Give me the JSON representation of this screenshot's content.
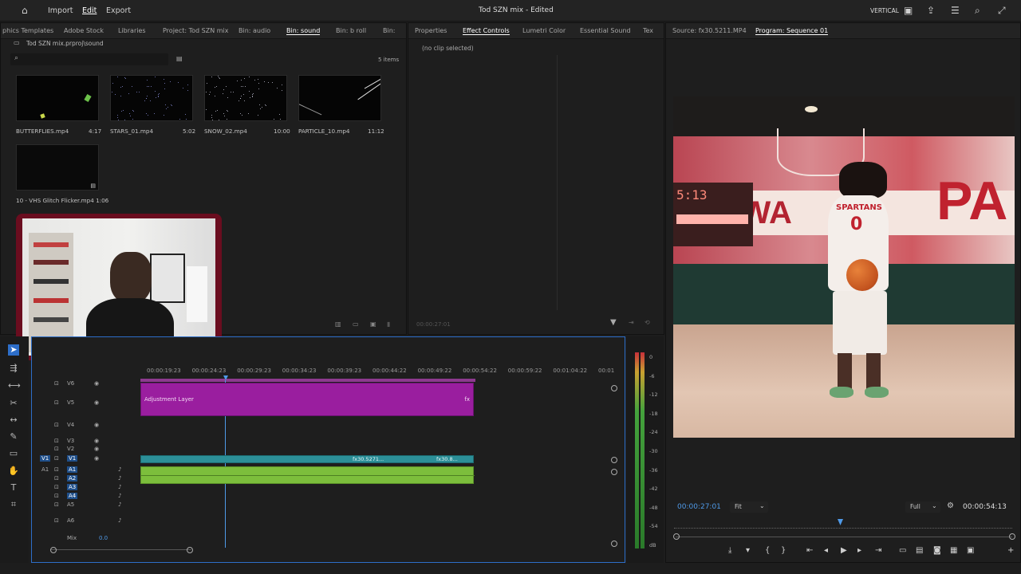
{
  "menu": {
    "import": "Import",
    "edit": "Edit",
    "export": "Export"
  },
  "title": "Tod SZN mix",
  "title_status": "- Edited",
  "workspace": "VERTICAL",
  "project_tabs": [
    "phics Templates",
    "Adobe Stock",
    "Libraries",
    "Project: Tod SZN mix",
    "Bin: audio",
    "Bin: sound",
    "Bin: b roll",
    "Bin:"
  ],
  "bin_path": "Tod SZN mix.prproj\\sound",
  "bin_count": "5 items",
  "media": [
    {
      "name": "BUTTERFLIES.mp4",
      "duration": "4:17"
    },
    {
      "name": "STARS_01.mp4",
      "duration": "5:02"
    },
    {
      "name": "SNOW_02.mp4",
      "duration": "10:00"
    },
    {
      "name": "PARTICLE_10.mp4",
      "duration": "11:12"
    },
    {
      "name": "10 - VHS Glitch Flicker.mp4",
      "duration": "1:06"
    }
  ],
  "effect_tabs": [
    "Properties",
    "Effect Controls",
    "Lumetri Color",
    "Essential Sound",
    "Tex"
  ],
  "no_clip": "(no clip selected)",
  "effect_time": "00:00:27:01",
  "source_tab": "Source: fx30.5211.MP4",
  "program_tab": "Program: Sequence 01",
  "program_time": "00:00:27:01",
  "program_fit": "Fit",
  "program_res": "Full",
  "program_duration": "00:00:54:13",
  "scoreboard": {
    "time": "5:13",
    "label_score": "5:13"
  },
  "frame_text": {
    "jersey": "SPARTANS",
    "number": "0",
    "wall_left": "REDWA",
    "wall_right": "PA"
  },
  "timeline": {
    "ruler": [
      "00:00:19:23",
      "00:00:24:23",
      "00:00:29:23",
      "00:00:34:23",
      "00:00:39:23",
      "00:00:44:22",
      "00:00:49:22",
      "00:00:54:22",
      "00:00:59:22",
      "00:01:04:22",
      "00:01"
    ],
    "tracks_video": [
      "V6",
      "V5",
      "V4",
      "V3",
      "V2",
      "V1"
    ],
    "tracks_audio": [
      "A1",
      "A2",
      "A3",
      "A4",
      "A5",
      "A6"
    ],
    "mix_label": "Mix",
    "mix_value": "0.0",
    "adjustment_label": "Adjustment Layer",
    "clip_labels": [
      "fx30.5271...",
      "fx30.8..."
    ],
    "source_v1": "V1",
    "source_a1": "A1"
  },
  "meter_scale": [
    "0",
    "-6",
    "-12",
    "-18",
    "-24",
    "-30",
    "-36",
    "-42",
    "-48",
    "-54",
    "dB"
  ],
  "colors": {
    "accent": "#2d8ceb",
    "adjustment": "#9a1e9f",
    "video_clip": "#2c8f98",
    "audio_clip": "#7cbe3c",
    "time_blue": "#4f9ae8"
  },
  "icons": [
    "home-icon",
    "search-icon",
    "folder-icon",
    "selection-tool-icon",
    "track-select-icon",
    "ripple-edit-icon",
    "razor-icon",
    "slip-icon",
    "pen-icon",
    "rectangle-icon",
    "hand-icon",
    "type-icon",
    "play-icon",
    "step-back-icon",
    "step-forward-icon",
    "filter-icon",
    "wrench-icon"
  ]
}
